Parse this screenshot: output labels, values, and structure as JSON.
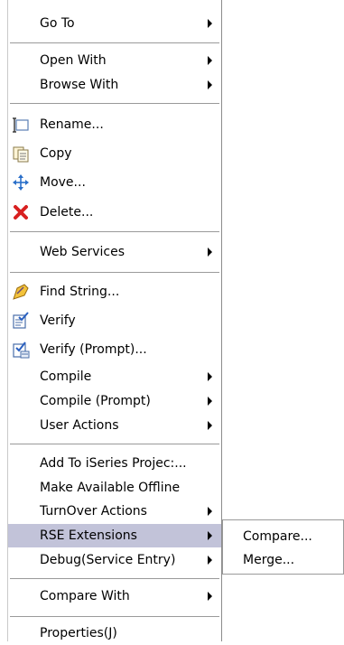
{
  "menu": {
    "items": [
      {
        "id": "go-to",
        "label": "Go To",
        "submenu": true
      },
      {
        "id": "open-with",
        "label": "Open With",
        "submenu": true
      },
      {
        "id": "browse-with",
        "label": "Browse With",
        "submenu": true
      },
      {
        "id": "rename",
        "label": "Rename...",
        "icon": "rename-icon"
      },
      {
        "id": "copy",
        "label": "Copy",
        "icon": "copy-icon"
      },
      {
        "id": "move",
        "label": "Move...",
        "icon": "move-icon"
      },
      {
        "id": "delete",
        "label": "Delete...",
        "icon": "delete-icon"
      },
      {
        "id": "web-services",
        "label": "Web Services",
        "submenu": true
      },
      {
        "id": "find-string",
        "label": "Find String...",
        "icon": "find-string-icon"
      },
      {
        "id": "verify",
        "label": "Verify",
        "icon": "verify-icon"
      },
      {
        "id": "verify-prompt",
        "label": "Verify (Prompt)...",
        "icon": "verify-prompt-icon"
      },
      {
        "id": "compile",
        "label": "Compile",
        "submenu": true
      },
      {
        "id": "compile-prompt",
        "label": "Compile (Prompt)",
        "submenu": true
      },
      {
        "id": "user-actions",
        "label": "User Actions",
        "submenu": true
      },
      {
        "id": "add-to-iseries",
        "label": "Add To iSeries Projec:..."
      },
      {
        "id": "make-available-offline",
        "label": "Make Available Offline"
      },
      {
        "id": "turnover-actions",
        "label": "TurnOver Actions",
        "submenu": true
      },
      {
        "id": "rse-extensions",
        "label": "RSE Extensions",
        "submenu": true,
        "highlighted": true
      },
      {
        "id": "debug-service-entry",
        "label": "Debug(Service Entry)",
        "submenu": true
      },
      {
        "id": "compare-with",
        "label": "Compare With",
        "submenu": true
      },
      {
        "id": "properties",
        "label": "Properties(J)"
      }
    ]
  },
  "submenu": {
    "parent": "RSE Extensions",
    "items": [
      {
        "id": "compare",
        "label": "Compare..."
      },
      {
        "id": "merge",
        "label": "Merge..."
      }
    ]
  },
  "colors": {
    "highlight": "#c2c3d9",
    "separator": "#9a9a9a",
    "delete_icon": "#d82020",
    "move_icon": "#2a6fc9"
  }
}
